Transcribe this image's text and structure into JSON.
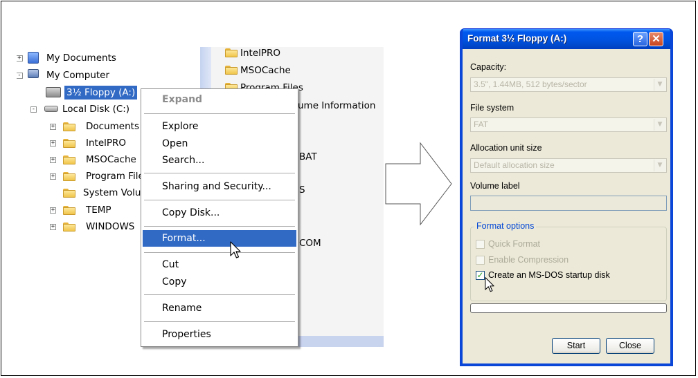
{
  "tree": {
    "items": [
      {
        "label": "My Documents",
        "expander": "+"
      },
      {
        "label": "My Computer",
        "expander": "-"
      },
      {
        "label": "3½ Floppy (A:)",
        "selected": true
      },
      {
        "label": "Local Disk (C:)",
        "expander": "-"
      },
      {
        "label": "Documents",
        "expander": "+"
      },
      {
        "label": "IntelPRO",
        "expander": "+"
      },
      {
        "label": "MSOCache",
        "expander": "+"
      },
      {
        "label": "Program File",
        "expander": "+"
      },
      {
        "label": "System Volu",
        "expander": ""
      },
      {
        "label": "TEMP",
        "expander": "+"
      },
      {
        "label": "WINDOWS",
        "expander": "+"
      }
    ]
  },
  "pane": {
    "items": [
      "IntelPRO",
      "MSOCache",
      "Program Files",
      "ume Information",
      "BAT",
      "S",
      "COM"
    ]
  },
  "context_menu": {
    "items": [
      "Expand",
      "Explore",
      "Open",
      "Search...",
      "Sharing and Security...",
      "Copy Disk...",
      "Format...",
      "Cut",
      "Copy",
      "Rename",
      "Properties"
    ],
    "highlighted": "Format..."
  },
  "dialog": {
    "title": "Format 3½ Floppy (A:)",
    "help_glyph": "?",
    "close_glyph": "✕",
    "capacity_label": "Capacity:",
    "capacity_value": "3.5\",  1.44MB, 512 bytes/sector",
    "filesystem_label": "File system",
    "filesystem_value": "FAT",
    "allocation_label": "Allocation unit size",
    "allocation_value": "Default allocation size",
    "volume_label": "Volume label",
    "volume_value": "",
    "options_title": "Format options",
    "quick_format": "Quick Format",
    "enable_compression": "Enable Compression",
    "msdos_startup": "Create an MS-DOS startup disk",
    "msdos_checked": true,
    "progress": 0,
    "start_button": "Start",
    "close_button": "Close"
  },
  "colors": {
    "selection": "#316ac5",
    "dialog_face": "#ece9d8",
    "titlebar": "#0054e3"
  }
}
